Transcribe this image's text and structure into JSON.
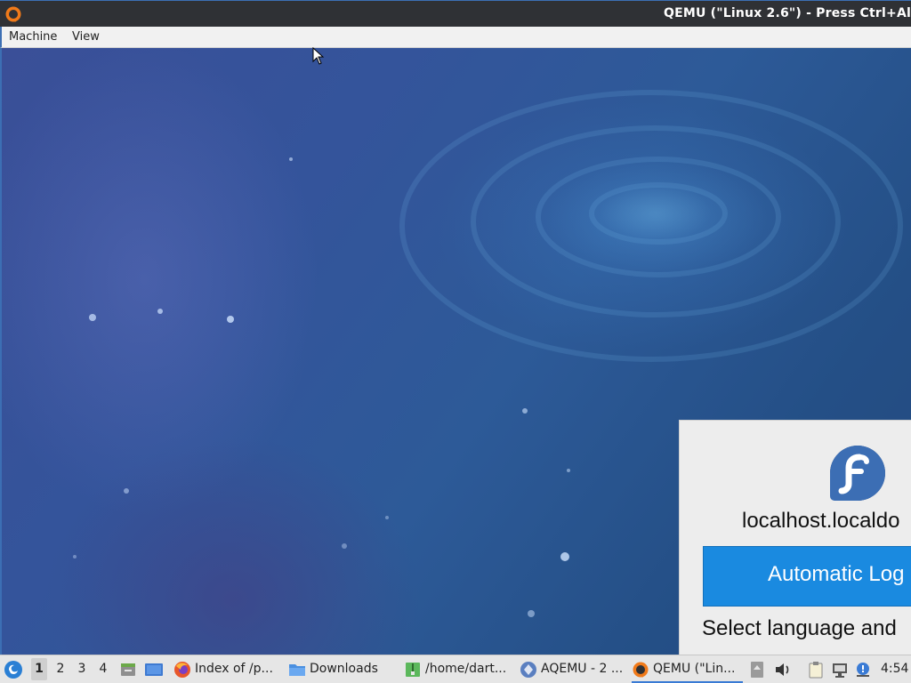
{
  "window": {
    "title": "QEMU (\"Linux 2.6\") - Press Ctrl+Al",
    "app_icon": "qemu-icon"
  },
  "menubar": {
    "items": [
      "Machine",
      "View"
    ]
  },
  "vm": {
    "login": {
      "logo": "fedora-icon",
      "hostname": "localhost.localdo",
      "button_label": "Automatic Log",
      "language_label": "Select language and"
    }
  },
  "taskbar": {
    "start_icon": "start-menu-icon",
    "workspaces": [
      "1",
      "2",
      "3",
      "4"
    ],
    "active_workspace": "1",
    "launchers": [
      "file-manager-icon",
      "desktop-icon"
    ],
    "tasks": [
      {
        "icon": "firefox-icon",
        "label": "Index of /p..."
      },
      {
        "icon": "folder-icon",
        "label": "Downloads"
      },
      {
        "icon": "archive-icon",
        "label": "/home/dart..."
      },
      {
        "icon": "aqemu-icon",
        "label": "AQEMU - 2 ..."
      },
      {
        "icon": "qemu-icon",
        "label": "QEMU (\"Lin..."
      }
    ],
    "active_task": "QEMU (\"Lin...",
    "tray_icons": [
      "drive-icon",
      "volume-icon",
      "clipboard-icon",
      "network-icon",
      "notification-icon"
    ],
    "clock": "4:54"
  },
  "colors": {
    "titlebar": "#2f3135",
    "accent": "#3c6fb4",
    "login_button": "#1a8ae0",
    "panel": "#ededed"
  }
}
